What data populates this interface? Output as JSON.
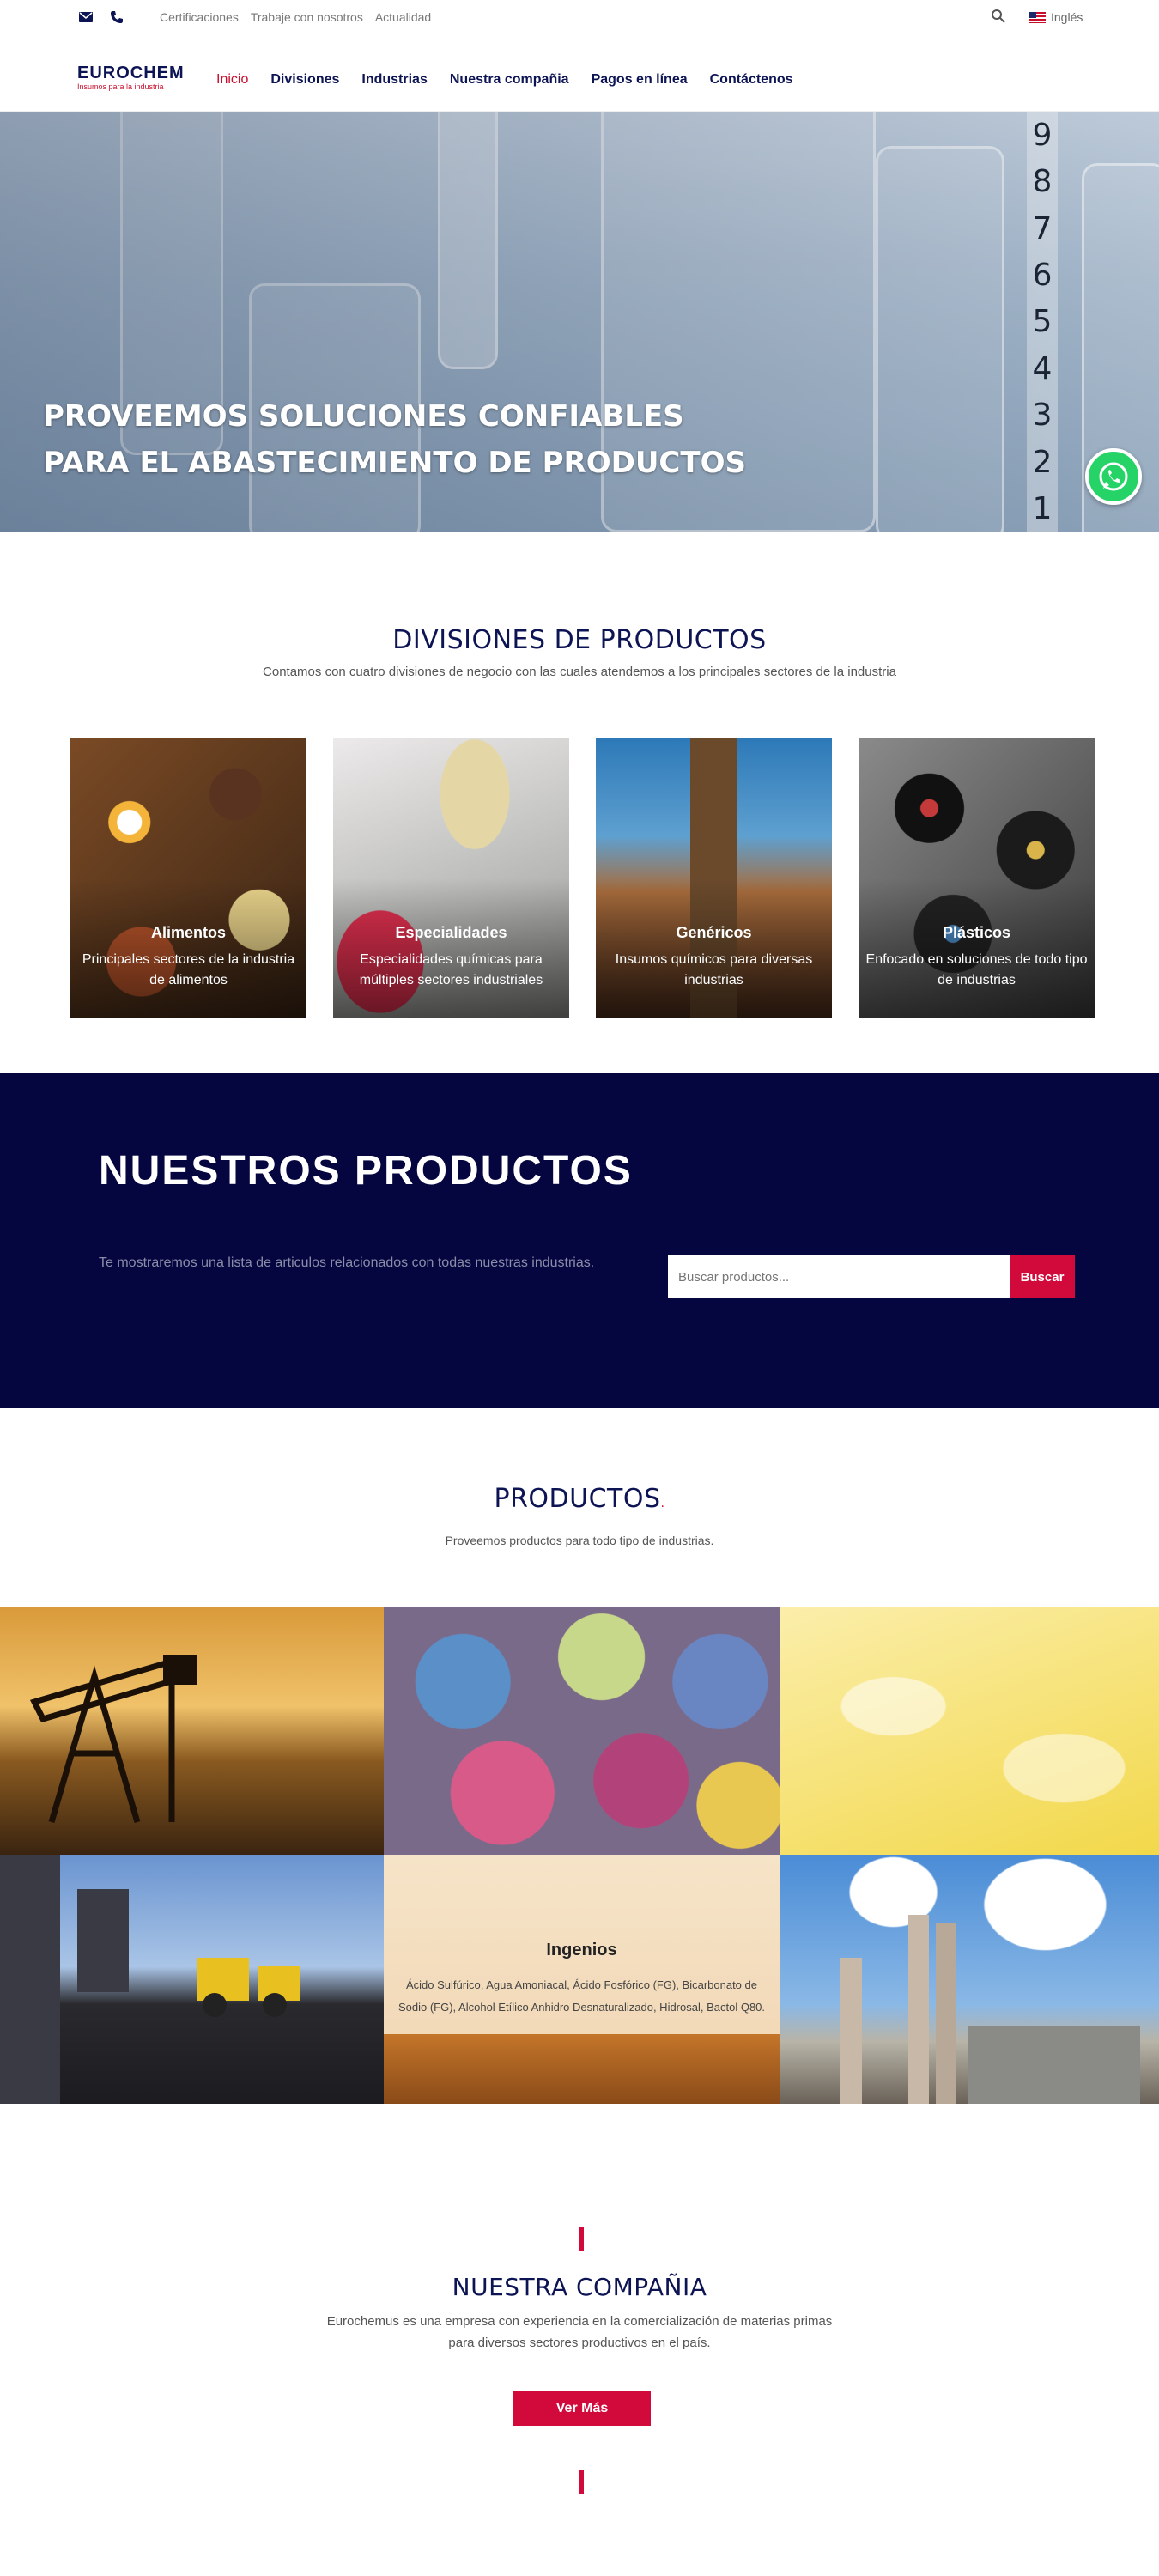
{
  "topbar": {
    "links": [
      "Certificaciones",
      "Trabaje con nosotros",
      "Actualidad"
    ],
    "language": "Inglés"
  },
  "nav": {
    "logo_main": "EUROCHEM",
    "logo_sub": "Insumos para la industria",
    "items": [
      {
        "label": "Inicio",
        "active": true
      },
      {
        "label": "Divisiones",
        "active": false
      },
      {
        "label": "Industrias",
        "active": false
      },
      {
        "label": "Nuestra compañia",
        "active": false
      },
      {
        "label": "Pagos en línea",
        "active": false
      },
      {
        "label": "Contáctenos",
        "active": false
      }
    ]
  },
  "hero": {
    "line1": "PROVEEMOS SOLUCIONES CONFIABLES",
    "line2": "PARA EL ABASTECIMIENTO DE PRODUCTOS",
    "scale_numbers": [
      "9",
      "8",
      "7",
      "6",
      "5",
      "4",
      "3",
      "2",
      "1"
    ]
  },
  "divisions": {
    "title": "DIVISIONES DE PRODUCTOS",
    "subtitle": "Contamos con cuatro divisiones de negocio con las cuales atendemos a los principales sectores de la industria",
    "cards": [
      {
        "title": "Alimentos",
        "desc": "Principales sectores de la industria de alimentos"
      },
      {
        "title": "Especialidades",
        "desc": "Especialidades químicas para múltiples sectores industriales"
      },
      {
        "title": "Genéricos",
        "desc": "Insumos químicos para diversas industrias"
      },
      {
        "title": "Plásticos",
        "desc": "Enfocado en soluciones de todo tipo de industrias"
      }
    ]
  },
  "products_band": {
    "title": "NUESTROS PRODUCTOS",
    "text": "Te mostraremos una lista de articulos relacionados con todas nuestras industrias.",
    "search_placeholder": "Buscar productos...",
    "search_button": "Buscar"
  },
  "products": {
    "title": "PRODUCTOS",
    "subtitle": "Proveemos productos para todo tipo de industrias.",
    "featured": {
      "name": "Ingenios",
      "desc": "Ácido Sulfúrico, Agua Amoniacal, Ácido Fosfórico (FG), Bicarbonato de Sodio (FG), Alcohol Etílico Anhidro Desnaturalizado, Hidrosal, Bactol Q80."
    }
  },
  "company": {
    "title": "NUESTRA COMPAÑIA",
    "text1": "Eurochemus es una empresa con experiencia en la comercialización de materias primas",
    "text2": "para diversos sectores productivos en el país.",
    "button": "Ver Más"
  },
  "colors": {
    "navy": "#0d1454",
    "red": "#d10a3b",
    "band": "#05053f",
    "whatsapp": "#25d366"
  }
}
